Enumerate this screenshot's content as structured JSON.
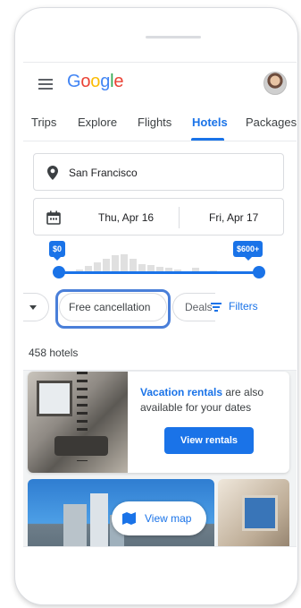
{
  "header": {
    "logo_letters": [
      "G",
      "o",
      "o",
      "g",
      "l",
      "e"
    ]
  },
  "tabs": [
    {
      "label": "Trips"
    },
    {
      "label": "Explore"
    },
    {
      "label": "Flights"
    },
    {
      "label": "Hotels",
      "active": true
    },
    {
      "label": "Packages"
    }
  ],
  "search": {
    "location": "San Francisco",
    "check_in": "Thu, Apr 16",
    "check_out": "Fri, Apr 17"
  },
  "price_filter": {
    "min_label": "$0",
    "max_label": "$600+",
    "selected_min_fraction": 0,
    "selected_max_fraction": 1,
    "histogram_relative": [
      0.1,
      0.25,
      0.4,
      0.6,
      0.75,
      0.8,
      0.6,
      0.35,
      0.3,
      0.2,
      0.15,
      0.1,
      0,
      0.15,
      0,
      0.05
    ]
  },
  "chips": {
    "free_cancellation": "Free cancellation",
    "deals": "Deals",
    "filters": "Filters"
  },
  "results": {
    "count_label": "458 hotels"
  },
  "promo": {
    "highlight": "Vacation rentals",
    "text": " are also available for your dates",
    "button": "View rentals"
  },
  "map_button": {
    "label": "View map"
  },
  "colors": {
    "accent": "#1a73e8",
    "focus_ring": "#4a7fd9"
  },
  "icons": [
    "menu-icon",
    "avatar",
    "location-pin-icon",
    "calendar-icon",
    "chevron-down-icon",
    "filter-icon",
    "map-icon"
  ]
}
